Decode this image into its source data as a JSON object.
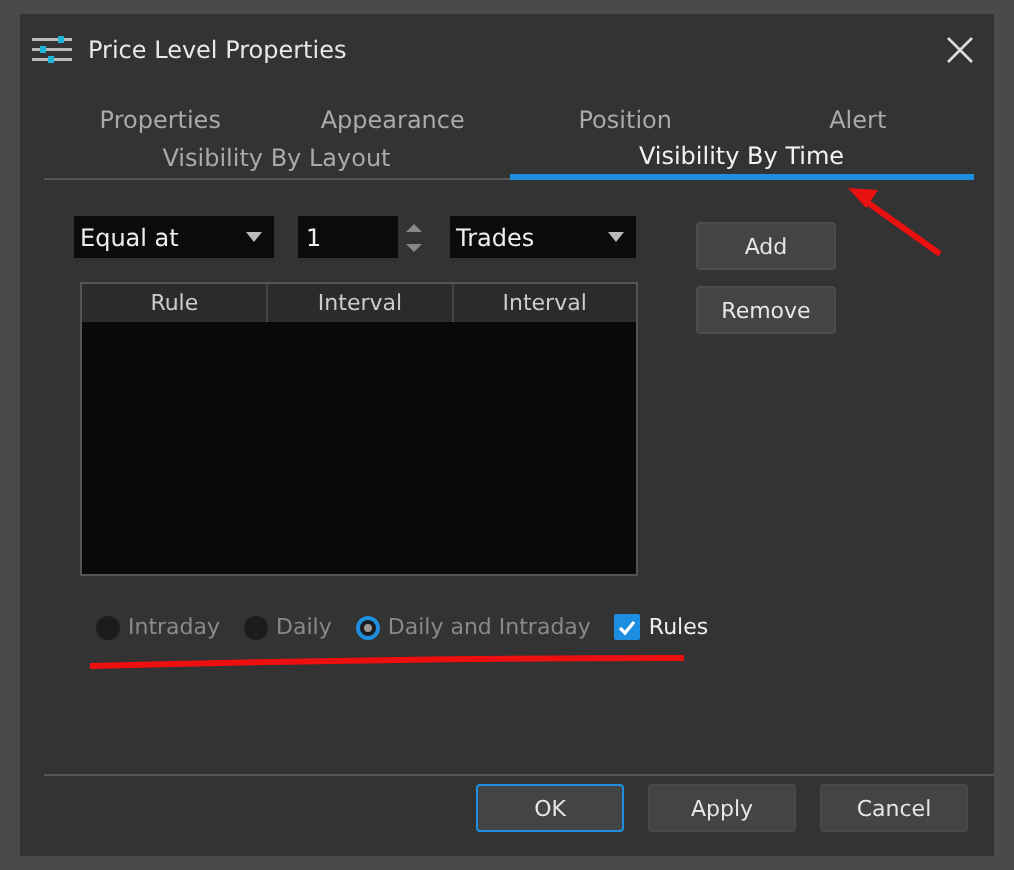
{
  "window": {
    "title": "Price Level Properties"
  },
  "tabs": [
    {
      "label": "Properties",
      "selected": false
    },
    {
      "label": "Appearance",
      "selected": false
    },
    {
      "label": "Position",
      "selected": false
    },
    {
      "label": "Alert",
      "selected": false
    },
    {
      "label": "Visibility By Layout",
      "selected": false
    },
    {
      "label": "Visibility By Time",
      "selected": true
    }
  ],
  "condition": {
    "value": "Equal at"
  },
  "count": {
    "value": "1"
  },
  "unit": {
    "value": "Trades"
  },
  "side_buttons": [
    "Add",
    "Remove"
  ],
  "table": {
    "columns": [
      "Rule",
      "Interval",
      "Interval"
    ]
  },
  "options": [
    {
      "kind": "radio",
      "label": "Intraday",
      "selected": false,
      "disabled": true
    },
    {
      "kind": "radio",
      "label": "Daily",
      "selected": false,
      "disabled": true
    },
    {
      "kind": "radio",
      "label": "Daily and Intraday",
      "selected": true,
      "disabled": true
    },
    {
      "kind": "checkbox",
      "label": "Rules",
      "checked": true,
      "disabled": false
    }
  ],
  "buttons": [
    {
      "label": "OK",
      "default": true
    },
    {
      "label": "Apply",
      "default": false
    },
    {
      "label": "Cancel",
      "default": false
    }
  ]
}
